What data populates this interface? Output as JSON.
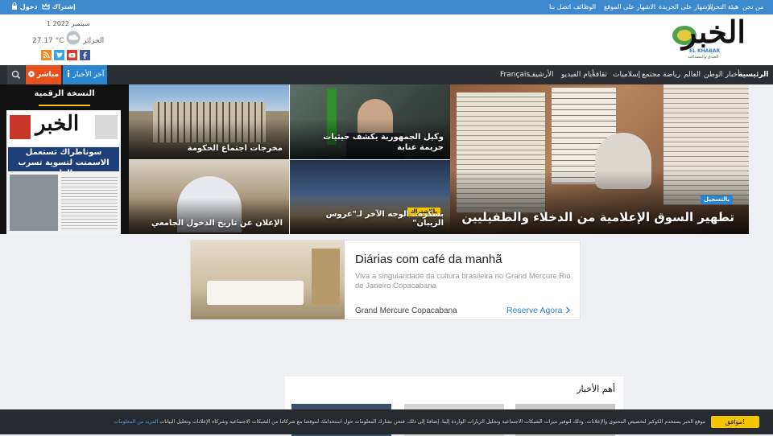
{
  "topbar": {
    "links": [
      "من نحن",
      "هيئة التحرير",
      "الاشهار على الجريدة",
      "الاشهار على الموقع",
      "الوظائف",
      "اتصل بنا"
    ],
    "subscribe": "إشتراك",
    "login": "دخول"
  },
  "header": {
    "date": "1 سبتمبر 2022",
    "city": "الجزائر",
    "temperature": "27.17 °C",
    "logo_text": "الخبر",
    "logo_latin": "EL KHABAR",
    "logo_tagline": "الصدق والمصداقية",
    "social": [
      "facebook",
      "youtube",
      "twitter",
      "rss"
    ]
  },
  "nav": {
    "items": [
      "الرئيسية",
      "أخبار الوطن",
      "العالم",
      "رياضة",
      "مجتمع",
      "إسلاميات",
      "ثقافة",
      "أيام الفيديو",
      "الأرشيف",
      "Français"
    ],
    "latest": "آخر الأخبار",
    "live": "مباشر"
  },
  "digital_edition": {
    "title": "النسخة الرقمية",
    "cover_masthead": "الخبر",
    "cover_headline": "سوناطراك تستعمل الاسمنت لتسوية تسرب الغاز"
  },
  "hero": {
    "main": {
      "tag": "بالتسجيل",
      "title": "تطهير السوق الإعلامية من الدخلاء والطفيليين"
    },
    "top_left": {
      "title": "مخرجات اجتماع الحكومة"
    },
    "top_right": {
      "title": "وكيل الجمهورية يكشف حيثيات جريمة عنابة"
    },
    "bottom_left": {
      "title": "الإعلان عن تاريخ الدخول الجامعي"
    },
    "bottom_right": {
      "tag": "بالاشتراك",
      "title": "بسكرة.. الوجه الآخر لـ\"عروس الزيبان\""
    }
  },
  "ad": {
    "headline": "Diárias com café da manhã",
    "body": "Viva a singularidade da cultura brasileira no Grand Mercure Rio de Janeiro Copacabana",
    "brand": "Grand Mercure Copacabana",
    "cta": "Reserve Agora"
  },
  "news": {
    "title": "أهم الأخبار"
  },
  "cookie": {
    "accept": "موافق!",
    "text": "موقع الخبر يستخدم الكوكيز لتخصيص المحتوى والإعلانات، وذلك لتوفير ميزات الشبكات الاجتماعية وتحليل الزيارات الواردة إلينا. إضافةً إلى ذلك، فنحن نشارك المعلومات حول استخدامك لموقعنا مع شركائنا من الشبكات الاجتماعية وشركاء الإعلانات وتحليل البيانات",
    "more": "المزيد من المعلومات"
  },
  "colors": {
    "topbar": "#3f8acf",
    "nav": "#2b2f33",
    "latest": "#2a86d1",
    "live": "#e8511e",
    "accent_yellow": "#f5c400",
    "logo_green": "#2f8f2f"
  }
}
